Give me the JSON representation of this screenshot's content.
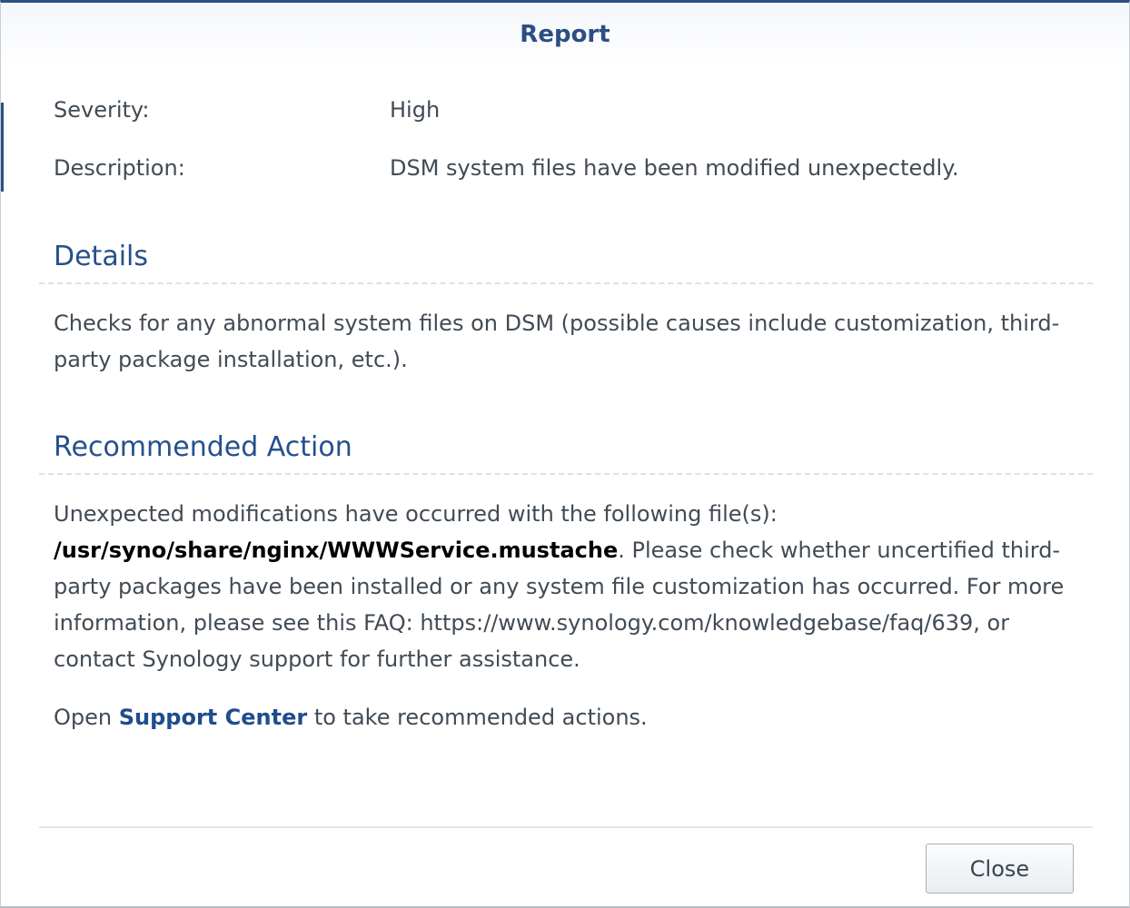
{
  "dialog": {
    "title": "Report"
  },
  "fields": {
    "severity_label": "Severity:",
    "severity_value": "High",
    "description_label": "Description:",
    "description_value": "DSM system files have been modified unexpectedly."
  },
  "details": {
    "heading": "Details",
    "text": "Checks for any abnormal system files on DSM (possible causes include customization, third-party package installation, etc.)."
  },
  "recommended_action": {
    "heading": "Recommended Action",
    "intro": "Unexpected modifications have occurred with the following file(s): ",
    "file_path": "/usr/syno/share/nginx/WWWService.mustache",
    "body": ". Please check whether uncertified third-party packages have been installed or any system file customization has occurred. For more information, please see this FAQ: https://www.synology.com/knowledgebase/faq/639, or contact Synology support for further assistance.",
    "open_prefix": "Open ",
    "support_center_link": "Support Center",
    "open_suffix": " to take recommended actions."
  },
  "footer": {
    "close_label": "Close"
  },
  "colors": {
    "accent": "#2b4f82",
    "heading": "#25508c",
    "text": "#414b55"
  }
}
